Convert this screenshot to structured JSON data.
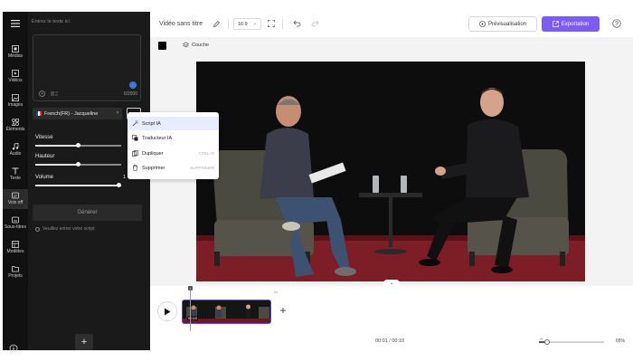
{
  "sidebar": {
    "items": [
      {
        "label": "Médias",
        "icon": "media-icon"
      },
      {
        "label": "Vidéos",
        "icon": "video-icon"
      },
      {
        "label": "Images",
        "icon": "image-icon"
      },
      {
        "label": "Éléments",
        "icon": "elements-icon"
      },
      {
        "label": "Audio",
        "icon": "music-icon"
      },
      {
        "label": "Texte",
        "icon": "text-icon"
      },
      {
        "label": "Voix off",
        "icon": "voiceover-icon"
      },
      {
        "label": "Sous-titres",
        "icon": "subtitles-icon"
      },
      {
        "label": "Modèles",
        "icon": "templates-icon"
      },
      {
        "label": "Projets",
        "icon": "folder-icon"
      }
    ]
  },
  "panel": {
    "script_placeholder": "Entrez le texte ici",
    "char_count": "0/2000",
    "voice": "French(FR) - Jacqueline",
    "speed_label": "Vitesse",
    "pitch_label": "Hauteur",
    "volume_label": "Volume",
    "volume_value": "1",
    "speed_level": 0.5,
    "pitch_level": 0.5,
    "volume_level": 1.0,
    "generate_label": "Générer",
    "warning": "Veuillez entrer votre script."
  },
  "menu": {
    "items": [
      {
        "label": "Script IA",
        "shortcut": "",
        "icon": "ai-wand-icon"
      },
      {
        "label": "Traducteur IA",
        "shortcut": "",
        "icon": "translate-icon"
      },
      {
        "label": "Dupliquer",
        "shortcut": "CTRL+D",
        "icon": "duplicate-icon"
      },
      {
        "label": "Supprimer",
        "shortcut": "SUPPRIMER",
        "icon": "trash-icon"
      }
    ]
  },
  "topbar": {
    "title": "Vidéo sans titre",
    "ratio": "16:9",
    "preview_label": "Prévisualisation",
    "export_label": "Exportation"
  },
  "canvas": {
    "layer_label": "Couche"
  },
  "timeline": {
    "clip_duration": "00:10",
    "marker": "0s",
    "time": "00:01 / 00:10",
    "zoom": "65%",
    "zoom_level": 0.12
  },
  "colors": {
    "accent": "#7c5cf5",
    "panel_bg": "#1a1a1a",
    "rail_bg": "#111111",
    "stage_red": "#7d1d25"
  }
}
